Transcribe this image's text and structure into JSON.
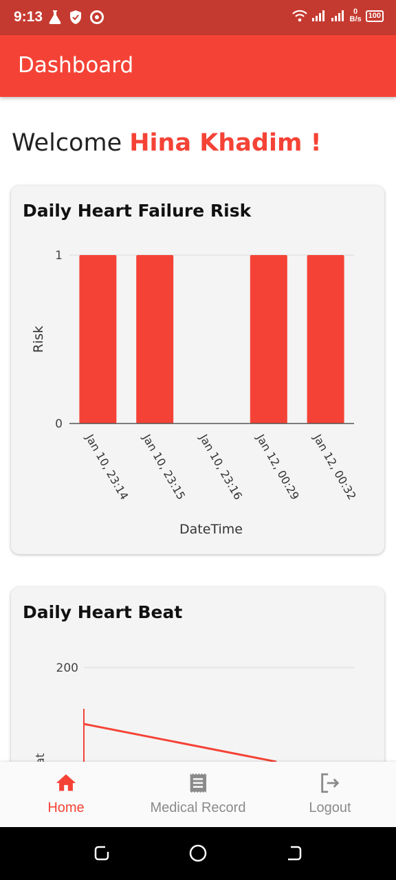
{
  "status_bar": {
    "time": "9:13",
    "net_speed_top": "0",
    "net_speed_unit": "B/s",
    "battery": "100"
  },
  "app_bar": {
    "title": "Dashboard"
  },
  "welcome": {
    "prefix": "Welcome",
    "name": "Hina Khadim !"
  },
  "risk_card": {
    "title": "Daily Heart Failure Risk",
    "chart_data": {
      "type": "bar",
      "categories": [
        "Jan 10, 23:14",
        "Jan 10, 23:15",
        "Jan 10, 23:16",
        "Jan 12, 00:29",
        "Jan 12, 00:32"
      ],
      "values": [
        1,
        1,
        0,
        1,
        1
      ],
      "ylim": [
        0,
        1
      ],
      "yticks": [
        "0",
        "1"
      ],
      "xlabel": "DateTime",
      "ylabel": "Risk",
      "bar_color": "#f44336"
    }
  },
  "beat_card": {
    "title": "Daily Heart Beat",
    "chart_data": {
      "type": "line",
      "ytick_visible": "200",
      "ylabel_partial": "at",
      "line_color": "#f44336"
    }
  },
  "nav": [
    {
      "label": "Home",
      "icon": "home-icon",
      "active": true
    },
    {
      "label": "Medical Record",
      "icon": "receipt-icon",
      "active": false
    },
    {
      "label": "Logout",
      "icon": "logout-icon",
      "active": false
    }
  ],
  "colors": {
    "primary": "#f44336",
    "status_bar": "#c53a30",
    "nav_inactive": "#8a8a8a"
  }
}
